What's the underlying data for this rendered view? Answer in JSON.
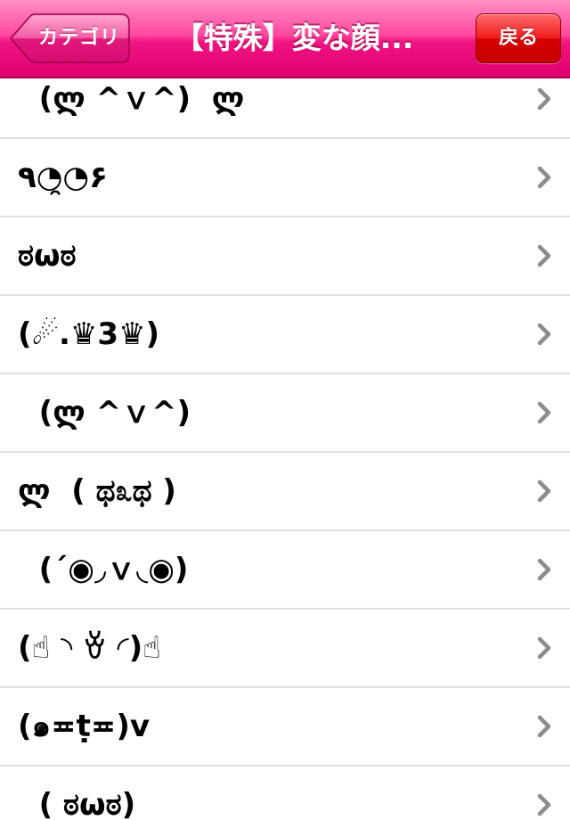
{
  "navbar": {
    "back_label": "カテゴリ",
    "title": "【特殊】変な顔...",
    "right_label": "戻る"
  },
  "colors": {
    "navbar_pink": "#f01482",
    "right_button_red": "#e00000",
    "chevron_gray": "#8c8c8c",
    "separator": "#e0e0e0"
  },
  "icons": {
    "row_disclosure": "chevron-right-icon",
    "back": "back-arrow-button-shape"
  },
  "list": {
    "items": [
      {
        "label": "  (ლ ^ｖ^)  ლ"
      },
      {
        "label": "٩◔̯◔۶"
      },
      {
        "label": "ಠωಠ"
      },
      {
        "label": "(☄.♛3♛)"
      },
      {
        "label": "  (ლ ^ｖ^)"
      },
      {
        "label": "ლ  ( ಥ೩ಥ )"
      },
      {
        "label": "  (´◉◞ｖ◟◉)"
      },
      {
        "label": "(☝ ◝ ꈊ ◜)☝"
      },
      {
        "label": "(๑≖ṭ≖)v"
      },
      {
        "label": "  ( ಠωಠ)"
      }
    ]
  }
}
